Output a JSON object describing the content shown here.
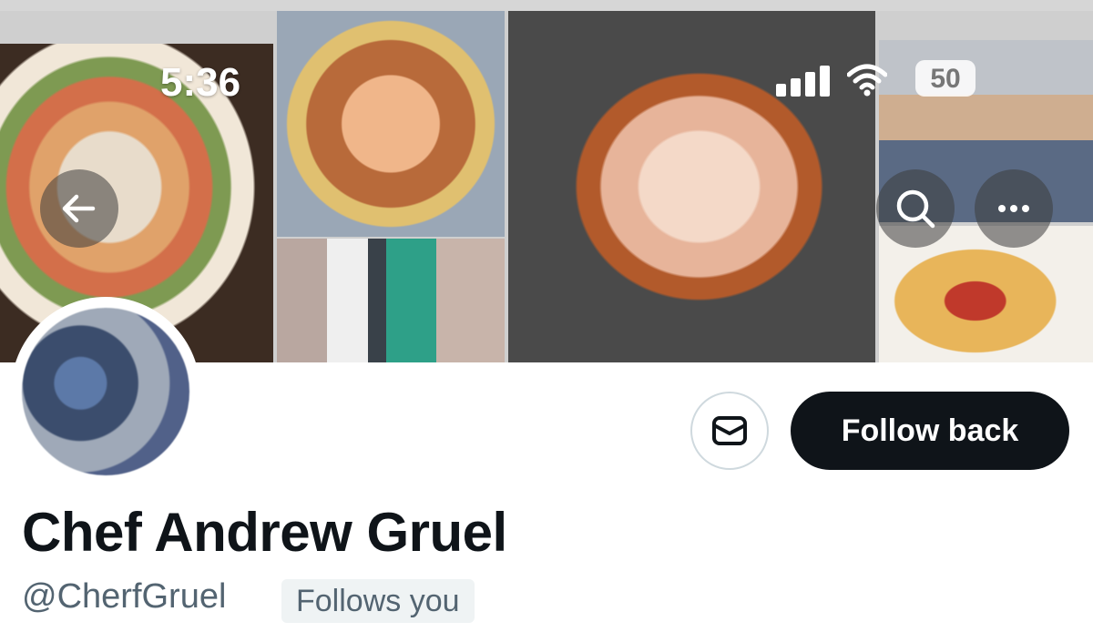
{
  "status_bar": {
    "time": "5:36",
    "battery": "50"
  },
  "header": {
    "back_icon": "arrow-left-icon",
    "search_icon": "search-icon",
    "more_icon": "more-horizontal-icon"
  },
  "profile": {
    "name": "Chef Andrew Gruel",
    "handle": "@CherfGruel",
    "follows_you_badge": "Follows you",
    "follow_button_label": "Follow back",
    "message_icon": "envelope-icon"
  },
  "colors": {
    "primary_text": "#0f1419",
    "secondary_text": "#536471",
    "button_dark": "#0f1419",
    "badge_bg": "#eff3f4"
  }
}
